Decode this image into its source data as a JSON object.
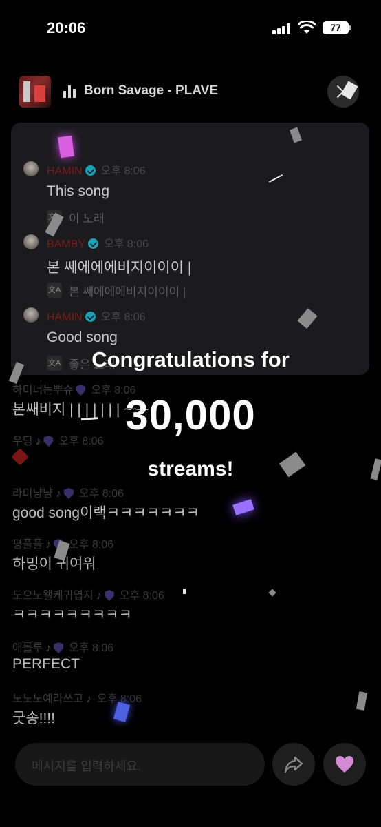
{
  "status_bar": {
    "time": "20:06",
    "battery": "77"
  },
  "now_playing": {
    "title": "Born Savage - PLAVE"
  },
  "pinned_messages": [
    {
      "name": "HAMIN",
      "time": "오후 8:06",
      "text": "This song",
      "translation": "이 노래"
    },
    {
      "name": "BAMBY",
      "time": "오후 8:06",
      "text": "본 쎄에에에비지이이이 |",
      "translation": "본 쎄에에에비지이이이 |"
    },
    {
      "name": "HAMIN",
      "time": "오후 8:06",
      "text": "Good song",
      "translation": "좋은 노래"
    }
  ],
  "chat_messages": [
    {
      "name": "하미너는뿌슈",
      "time": "오후 8:06",
      "text": "본쌔비지 | | | | | | | ~~~"
    },
    {
      "name": "우딩",
      "time": "오후 8:06",
      "text": ""
    },
    {
      "name": "라미냥냥",
      "time": "오후 8:06",
      "text": "good song이랙ㅋㅋㅋㅋㅋㅋㅋ"
    },
    {
      "name": "평플플",
      "time": "오후 8:06",
      "text": "하밍이 귀여워"
    },
    {
      "name": "도으노왤케귀엽지",
      "time": "오후 8:06",
      "text": "ㅋㅋㅋㅋㅋㅋㅋㅋㅋ"
    },
    {
      "name": "애롤루",
      "time": "오후 8:06",
      "text": "PERFECT"
    },
    {
      "name": "노노노예라쓰고",
      "time": "오후 8:06",
      "text": "굿송!!!!"
    }
  ],
  "composer": {
    "placeholder": "메시지를 입력하세요."
  },
  "congrats": {
    "line1": "Congratulations for",
    "count": "30,000",
    "line3": "streams!"
  },
  "icons": {
    "translate": "translate-icon",
    "share": "share-icon",
    "like": "heart-icon",
    "verified": "verified-badge-icon",
    "music_note": "music-note-icon",
    "shield": "shield-badge-icon"
  },
  "colors": {
    "background": "#000000",
    "panel": "#1b1b1d",
    "pinned_name": "#7a1c1c",
    "verified": "#1aa2b8",
    "heart": "#d58ad6"
  }
}
